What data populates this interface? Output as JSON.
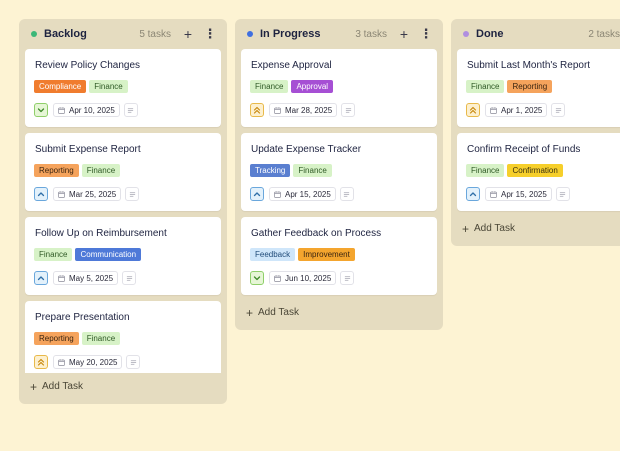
{
  "columns": [
    {
      "title": "Backlog",
      "count": "5 tasks",
      "dot_color": "#3cb878",
      "add_task": "Add Task",
      "cards": [
        {
          "title": "Review Policy Changes",
          "tags": [
            {
              "label": "Compliance",
              "bg": "#f07c2e",
              "fg": "#ffffff"
            },
            {
              "label": "Finance",
              "bg": "#d7f2c7",
              "fg": "#2f5a26"
            }
          ],
          "priority": "low",
          "date": "Apr 10, 2025"
        },
        {
          "title": "Submit Expense Report",
          "tags": [
            {
              "label": "Reporting",
              "bg": "#f5a35c",
              "fg": "#3a2410"
            },
            {
              "label": "Finance",
              "bg": "#d7f2c7",
              "fg": "#2f5a26"
            }
          ],
          "priority": "medium",
          "date": "Mar 25, 2025"
        },
        {
          "title": "Follow Up on Reimbursement",
          "tags": [
            {
              "label": "Finance",
              "bg": "#d7f2c7",
              "fg": "#2f5a26"
            },
            {
              "label": "Communication",
              "bg": "#4e79d8",
              "fg": "#ffffff"
            }
          ],
          "priority": "medium",
          "date": "May 5, 2025"
        },
        {
          "title": "Prepare Presentation",
          "tags": [
            {
              "label": "Reporting",
              "bg": "#f5a35c",
              "fg": "#3a2410"
            },
            {
              "label": "Finance",
              "bg": "#d7f2c7",
              "fg": "#2f5a26"
            }
          ],
          "priority": "high",
          "date": "May 20, 2025"
        }
      ]
    },
    {
      "title": "In Progress",
      "count": "3 tasks",
      "dot_color": "#3f6fe0",
      "add_task": "Add Task",
      "cards": [
        {
          "title": "Expense Approval",
          "tags": [
            {
              "label": "Finance",
              "bg": "#d7f2c7",
              "fg": "#2f5a26"
            },
            {
              "label": "Approval",
              "bg": "#a64fd4",
              "fg": "#ffffff"
            }
          ],
          "priority": "high",
          "date": "Mar 28, 2025"
        },
        {
          "title": "Update Expense Tracker",
          "tags": [
            {
              "label": "Tracking",
              "bg": "#5a7fd0",
              "fg": "#ffffff"
            },
            {
              "label": "Finance",
              "bg": "#d7f2c7",
              "fg": "#2f5a26"
            }
          ],
          "priority": "medium",
          "date": "Apr 15, 2025"
        },
        {
          "title": "Gather Feedback on Process",
          "tags": [
            {
              "label": "Feedback",
              "bg": "#cfe6fa",
              "fg": "#1f4a78"
            },
            {
              "label": "Improvement",
              "bg": "#f4a52e",
              "fg": "#3a2410"
            }
          ],
          "priority": "low",
          "date": "Jun 10, 2025"
        }
      ]
    },
    {
      "title": "Done",
      "count": "2 tasks",
      "dot_color": "#b08ee0",
      "add_task": "Add Task",
      "cards": [
        {
          "title": "Submit Last Month's Report",
          "tags": [
            {
              "label": "Finance",
              "bg": "#d7f2c7",
              "fg": "#2f5a26"
            },
            {
              "label": "Reporting",
              "bg": "#f5a35c",
              "fg": "#3a2410"
            }
          ],
          "priority": "high",
          "date": "Apr 1, 2025"
        },
        {
          "title": "Confirm Receipt of Funds",
          "tags": [
            {
              "label": "Finance",
              "bg": "#d7f2c7",
              "fg": "#2f5a26"
            },
            {
              "label": "Confirmation",
              "bg": "#f6cf2b",
              "fg": "#3a3010"
            }
          ],
          "priority": "medium",
          "date": "Apr 15, 2025"
        }
      ]
    }
  ],
  "priority_styles": {
    "low": {
      "icon": "chevron-down-icon",
      "bg": "#e6f6d6",
      "border": "#8fcf6a",
      "color": "#3f8a2a"
    },
    "medium": {
      "icon": "chevron-up-icon",
      "bg": "#e3f1fb",
      "border": "#6aa7dc",
      "color": "#2f6fa8"
    },
    "high": {
      "icon": "double-chevron-up-icon",
      "bg": "#fdf0cf",
      "border": "#e8b94a",
      "color": "#c98a10"
    }
  }
}
